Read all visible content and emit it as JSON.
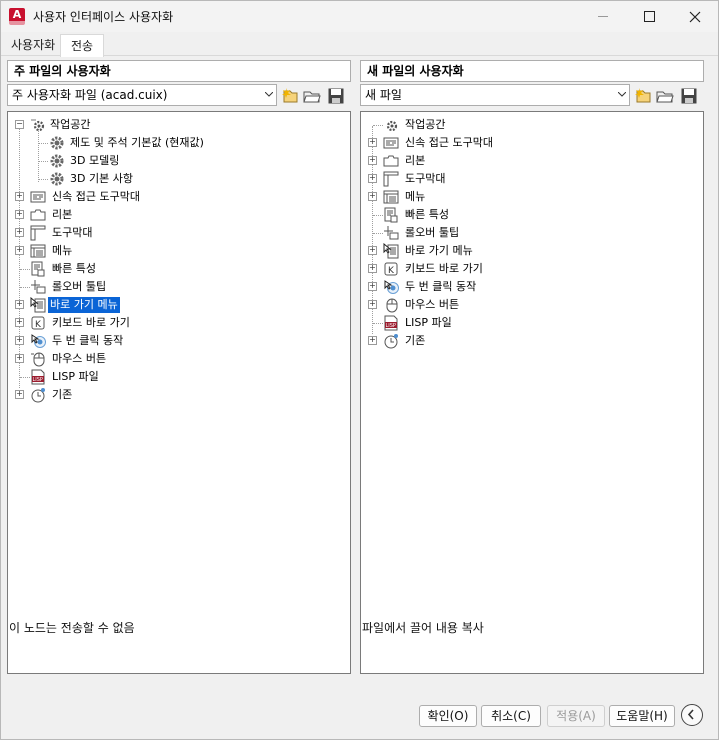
{
  "window": {
    "title": "사용자 인터페이스 사용자화",
    "app_icon_letter": "A"
  },
  "tabs": [
    {
      "label": "사용자화"
    },
    {
      "label": "전송",
      "active": true
    }
  ],
  "left_panel": {
    "header": "주 파일의 사용자화",
    "file_combo": "주 사용자화 파일 (acad.cuix)",
    "status": "이 노드는 전송할 수 없음",
    "tree": [
      {
        "label": "작업공간",
        "icon": "workspace-gear-icon",
        "expanded": true
      },
      {
        "label": "제도 및 주석 기본값 (현재값)",
        "icon": "gear-icon"
      },
      {
        "label": "3D 모델링",
        "icon": "gear-icon"
      },
      {
        "label": "3D 기본 사항",
        "icon": "gear-icon"
      },
      {
        "label": "신속 접근 도구막대",
        "icon": "quick-access-toolbar-icon"
      },
      {
        "label": "리본",
        "icon": "ribbon-icon"
      },
      {
        "label": "도구막대",
        "icon": "toolbar-icon"
      },
      {
        "label": "메뉴",
        "icon": "menu-icon"
      },
      {
        "label": "빠른 특성",
        "icon": "quick-properties-icon"
      },
      {
        "label": "롤오버 툴팁",
        "icon": "rollover-tooltip-icon"
      },
      {
        "label": "바로 가기 메뉴",
        "icon": "shortcut-menu-icon",
        "selected": true
      },
      {
        "label": "키보드 바로 가기",
        "icon": "keyboard-shortcut-icon"
      },
      {
        "label": "두 번 클릭 동작",
        "icon": "double-click-icon"
      },
      {
        "label": "마우스 버튼",
        "icon": "mouse-icon"
      },
      {
        "label": "LISP 파일",
        "icon": "lisp-file-icon"
      },
      {
        "label": "기존",
        "icon": "legacy-clock-icon"
      }
    ]
  },
  "right_panel": {
    "header": "새 파일의 사용자화",
    "file_combo": "새 파일",
    "status": "파일에서 끌어 내용 복사",
    "tree": [
      {
        "label": "작업공간",
        "icon": "workspace-gear-icon"
      },
      {
        "label": "신속 접근 도구막대",
        "icon": "quick-access-toolbar-icon"
      },
      {
        "label": "리본",
        "icon": "ribbon-icon"
      },
      {
        "label": "도구막대",
        "icon": "toolbar-icon"
      },
      {
        "label": "메뉴",
        "icon": "menu-icon"
      },
      {
        "label": "빠른 특성",
        "icon": "quick-properties-icon"
      },
      {
        "label": "롤오버 툴팁",
        "icon": "rollover-tooltip-icon"
      },
      {
        "label": "바로 가기 메뉴",
        "icon": "shortcut-menu-icon"
      },
      {
        "label": "키보드 바로 가기",
        "icon": "keyboard-shortcut-icon"
      },
      {
        "label": "두 번 클릭 동작",
        "icon": "double-click-icon"
      },
      {
        "label": "마우스 버튼",
        "icon": "mouse-icon"
      },
      {
        "label": "LISP 파일",
        "icon": "lisp-file-icon"
      },
      {
        "label": "기존",
        "icon": "legacy-clock-icon"
      }
    ]
  },
  "buttons": {
    "ok": "확인(O)",
    "cancel": "취소(C)",
    "apply": "적용(A)",
    "help": "도움말(H)"
  },
  "colors": {
    "selection": "#0a64d6",
    "accent": "#c8102e"
  }
}
